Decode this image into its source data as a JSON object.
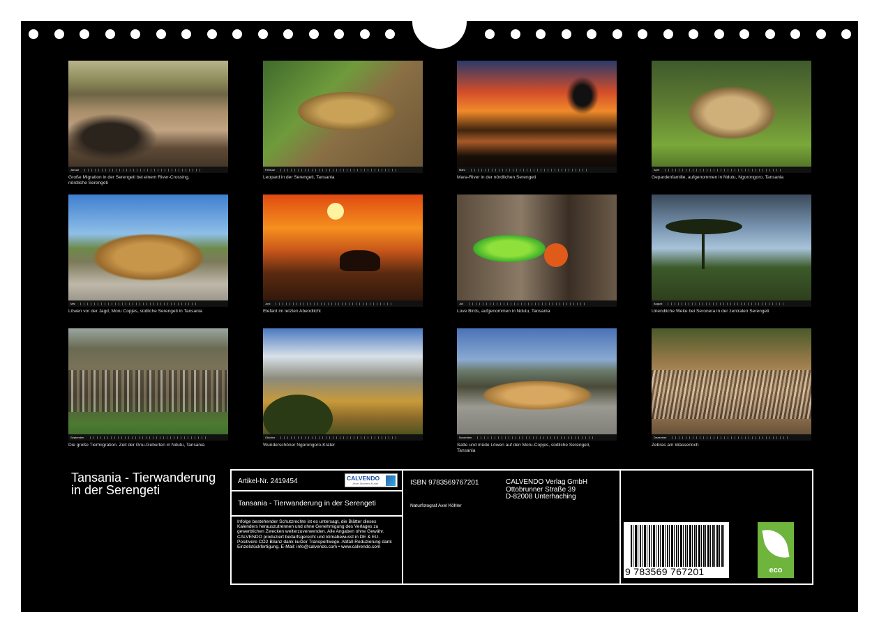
{
  "photos": [
    {
      "month": "Januar",
      "caption": "Große Migration in der Serengeti bei einem River-Crossing, nördliche Serengeti"
    },
    {
      "month": "Februar",
      "caption": "Leopard in der Serengeti, Tansania"
    },
    {
      "month": "März",
      "caption": "Mara-River in der nördlichen Serengeti"
    },
    {
      "month": "April",
      "caption": "Gepardenfamilie, aufgenommen in Ndutu, Ngorongoro, Tansania"
    },
    {
      "month": "Mai",
      "caption": "Löwen vor der Jagd, Moru Copjes, südliche Serengeti in Tansania"
    },
    {
      "month": "Juni",
      "caption": "Elefant im letzten Abendlicht"
    },
    {
      "month": "Juli",
      "caption": "Love Birds, aufgenommen in Ndutu, Tansania"
    },
    {
      "month": "August",
      "caption": "Unendliche Weite bei Seronera in der zentralen Serengeti"
    },
    {
      "month": "September",
      "caption": "Die große Tiermigration. Zeit der Gnu-Geburten in Ndutu, Tansania"
    },
    {
      "month": "Oktober",
      "caption": "Wunderschöner Ngorongoro-Krater"
    },
    {
      "month": "November",
      "caption": "Satte und müde Löwen auf den Moru-Copjes, südliche Serengeti, Tansania"
    },
    {
      "month": "Dezember",
      "caption": "Zebras am Wasserloch"
    }
  ],
  "calendar_title": "Tansania - Tierwanderung in der Serengeti",
  "info": {
    "article_no": "Artikel-Nr. 2419454",
    "logo_text": "CALVENDO",
    "logo_sub": "Jeder Moment Kunst",
    "title": "Tansania - Tierwanderung in der Serengeti",
    "legal": "Infolge bestehender Schutzrechte ist es untersagt, die Blätter dieses Kalenders herauszutrennen und ohne Genehmigung des Verlages zu gewerblichen Zwecken weiterzuverwenden. Alle Angaben ohne Gewähr. CALVENDO produziert bedarfsgerecht und klimabewusst in DE & EU. Positivere CO2-Bilanz dank kurzer Transportwege. Abfall-Reduzierung dank Einzelstückfertigung. E-Mail: info@calvendo.com • www.calvendo.com",
    "isbn": "ISBN 9783569767201",
    "publisher_name": "CALVENDO Verlag GmbH",
    "publisher_street": "Ottobrunner Straße 39",
    "publisher_city": "D-82008 Unterhaching",
    "photographer": "Naturfotograf Axel Köhler",
    "barcode_number": "9 783569 767201",
    "eco_label": "eco"
  }
}
